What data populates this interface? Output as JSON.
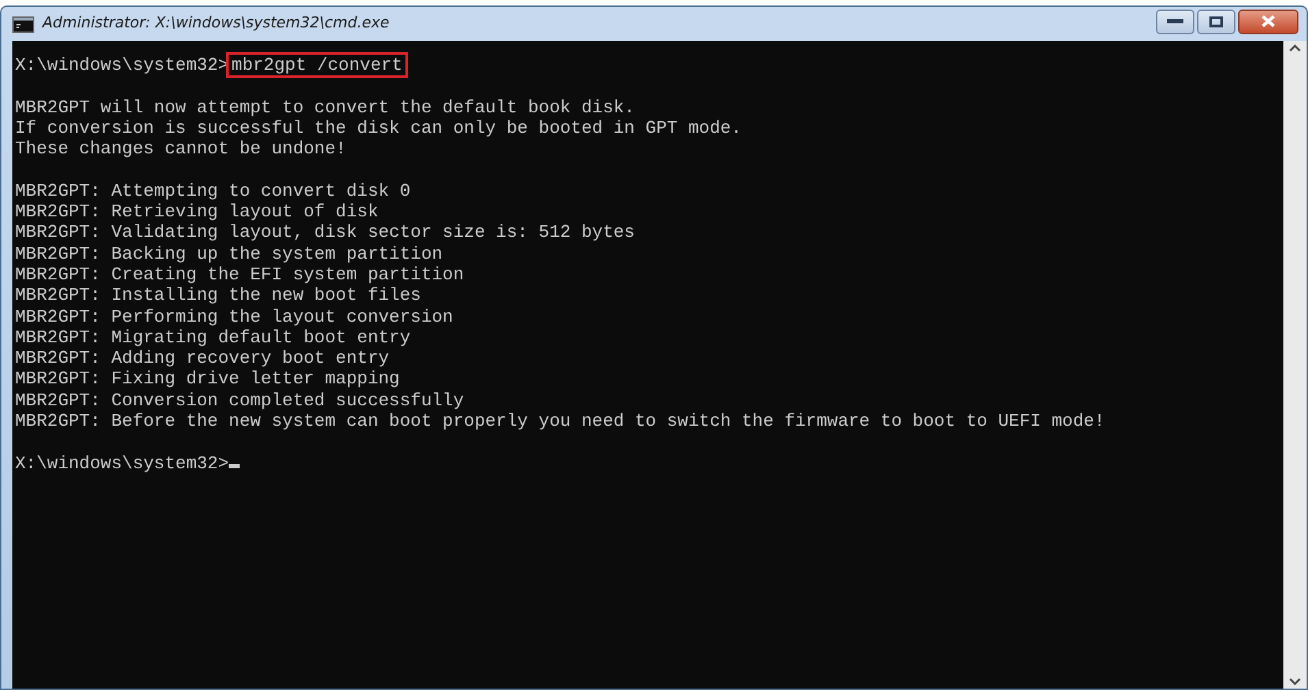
{
  "window": {
    "title": "Administrator: X:\\windows\\system32\\cmd.exe"
  },
  "console": {
    "lines": [
      {
        "kind": "command",
        "prompt": "X:\\windows\\system32>",
        "command": "mbr2gpt /convert"
      },
      {
        "kind": "blank"
      },
      {
        "kind": "output",
        "text": "MBR2GPT will now attempt to convert the default book disk."
      },
      {
        "kind": "output",
        "text": "If conversion is successful the disk can only be booted in GPT mode."
      },
      {
        "kind": "output",
        "text": "These changes cannot be undone!"
      },
      {
        "kind": "blank"
      },
      {
        "kind": "output",
        "text": "MBR2GPT: Attempting to convert disk 0"
      },
      {
        "kind": "output",
        "text": "MBR2GPT: Retrieving layout of disk"
      },
      {
        "kind": "output",
        "text": "MBR2GPT: Validating layout, disk sector size is: 512 bytes"
      },
      {
        "kind": "output",
        "text": "MBR2GPT: Backing up the system partition"
      },
      {
        "kind": "output",
        "text": "MBR2GPT: Creating the EFI system partition"
      },
      {
        "kind": "output",
        "text": "MBR2GPT: Installing the new boot files"
      },
      {
        "kind": "output",
        "text": "MBR2GPT: Performing the layout conversion"
      },
      {
        "kind": "output",
        "text": "MBR2GPT: Migrating default boot entry"
      },
      {
        "kind": "output",
        "text": "MBR2GPT: Adding recovery boot entry"
      },
      {
        "kind": "output",
        "text": "MBR2GPT: Fixing drive letter mapping"
      },
      {
        "kind": "output",
        "text": "MBR2GPT: Conversion completed successfully"
      },
      {
        "kind": "output",
        "text": "MBR2GPT: Before the new system can boot properly you need to switch the firmware to boot to UEFI mode!"
      },
      {
        "kind": "blank"
      },
      {
        "kind": "prompt",
        "prompt": "X:\\windows\\system32>"
      }
    ]
  }
}
